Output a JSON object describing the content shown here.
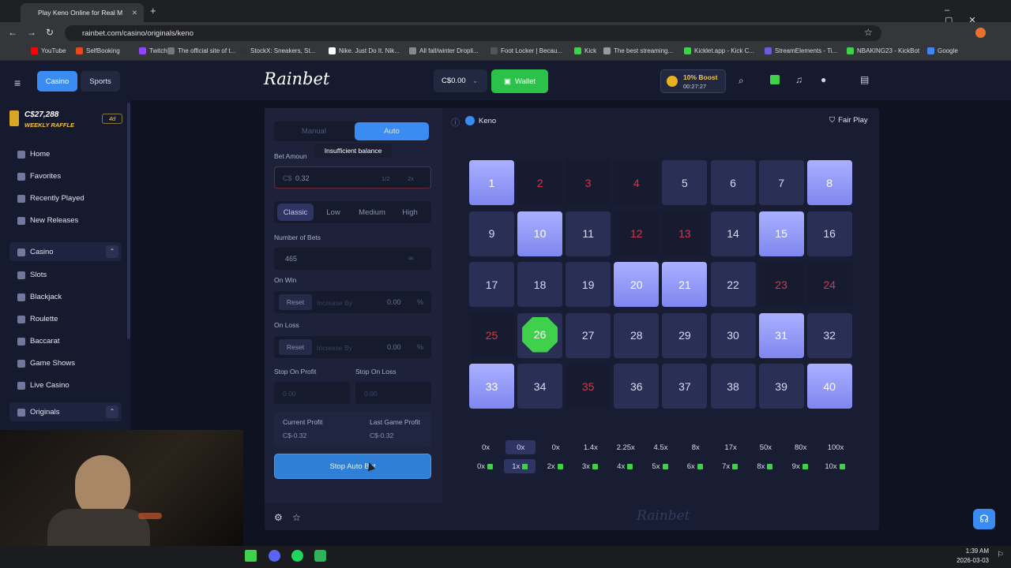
{
  "browser": {
    "tab_title": "Play Keno Online for Real M",
    "url": "rainbet.com/casino/originals/keno",
    "bookmarks": [
      "YouTube",
      "SelfBooking",
      "Twitch",
      "The official site of t...",
      "StockX: Sneakers, St...",
      "Nike. Just Do It. Nik...",
      "All fall/winter Dropli...",
      "Foot Locker | Becau...",
      "Kick",
      "The best streaming...",
      "Kicklet.app - Kick C...",
      "StreamElements - Ti...",
      "NBAKING23 - KickBot",
      "Google"
    ]
  },
  "header": {
    "casino_tab": "Casino",
    "sports_tab": "Sports",
    "logo": "Rainbet",
    "balance": "C$0.00",
    "wallet_label": "Wallet",
    "boost_label": "10% Boost",
    "boost_timer": "00:27:27"
  },
  "sidebar": {
    "raffle_amount": "C$27,288",
    "raffle_label": "WEEKLY RAFFLE",
    "raffle_days": "4d",
    "items": [
      "Home",
      "Favorites",
      "Recently Played",
      "New Releases"
    ],
    "casino_group": "Casino",
    "casino_items": [
      "Slots",
      "Blackjack",
      "Roulette",
      "Baccarat",
      "Game Shows",
      "Live Casino"
    ],
    "originals_group": "Originals"
  },
  "controls": {
    "manual_tab": "Manual",
    "auto_tab": "Auto",
    "bet_amount_label": "Bet Amoun",
    "tooltip": "Insufficient balance",
    "currency": "C$",
    "bet_value": "0.32",
    "half": "1/2",
    "double": "2x",
    "risk": [
      "Classic",
      "Low",
      "Medium",
      "High"
    ],
    "num_bets_label": "Number of Bets",
    "num_bets_value": "465",
    "on_win_label": "On Win",
    "on_loss_label": "On Loss",
    "reset_label": "Reset",
    "increase_by": "Increase By",
    "zero_value": "0.00",
    "percent": "%",
    "stop_profit_label": "Stop On Profit",
    "stop_loss_label": "Stop On Loss",
    "stop_profit_value": "0.00",
    "stop_loss_value": "0.00",
    "current_profit_label": "Current Profit",
    "current_profit_value": "C$-0.32",
    "last_profit_label": "Last Game Profit",
    "last_profit_value": "C$-0.32",
    "stop_auto_label": "Stop Auto Bet"
  },
  "game": {
    "title": "Keno",
    "fair_play": "Fair Play",
    "watermark": "Rainbet",
    "selected": [
      1,
      8,
      10,
      15,
      20,
      21,
      31,
      33,
      40
    ],
    "drawn_miss": [
      2,
      3,
      4,
      12,
      13,
      23,
      24,
      25,
      35
    ],
    "drawn_hit": [
      26
    ],
    "multipliers": [
      "0x",
      "0x",
      "0x",
      "1.4x",
      "2.25x",
      "4.5x",
      "8x",
      "17x",
      "50x",
      "80x",
      "100x"
    ],
    "hit_counts": [
      "0x",
      "1x",
      "2x",
      "3x",
      "4x",
      "5x",
      "6x",
      "7x",
      "8x",
      "9x",
      "10x"
    ],
    "active_multiplier_index": 1
  },
  "clock": {
    "time": "1:39 AM",
    "date": "2026-03-03"
  }
}
